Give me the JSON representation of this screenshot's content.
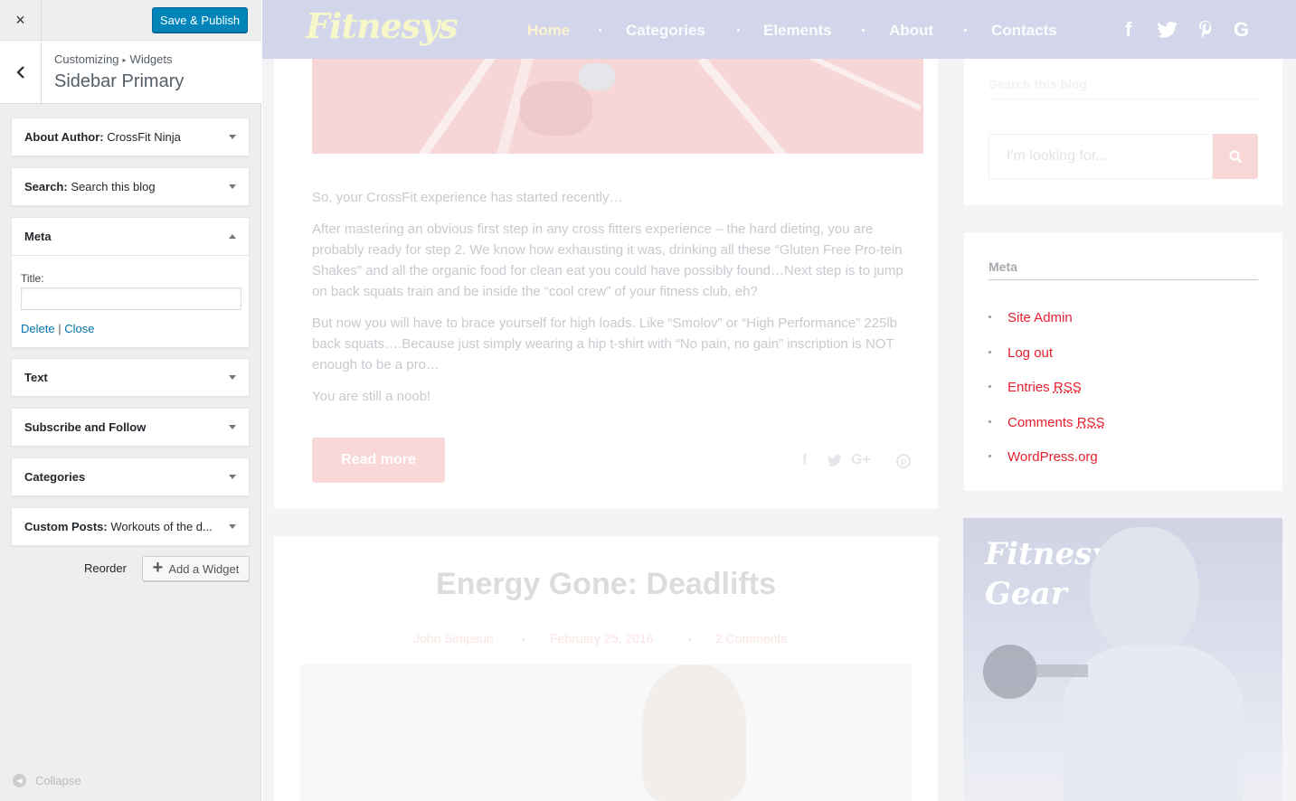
{
  "customizer": {
    "close_label": "×",
    "publish_label": "Save & Publish",
    "breadcrumb": [
      "Customizing",
      "Widgets"
    ],
    "section_title": "Sidebar Primary",
    "widgets": [
      {
        "name": "About Author",
        "value": "CrossFit Ninja"
      },
      {
        "name": "Search",
        "value": "Search this blog"
      },
      {
        "name": "Meta",
        "value": ""
      },
      {
        "name": "Text",
        "value": ""
      },
      {
        "name": "Subscribe and Follow",
        "value": ""
      },
      {
        "name": "Categories",
        "value": ""
      },
      {
        "name": "Custom Posts",
        "value": "Workouts of the d..."
      }
    ],
    "meta_form": {
      "title_label": "Title:",
      "title_value": "",
      "delete_label": "Delete",
      "separator": "|",
      "close_label": "Close"
    },
    "reorder_label": "Reorder",
    "add_widget_label": "Add a Widget",
    "collapse_label": "Collapse"
  },
  "site": {
    "logo": "Fitnesys",
    "nav": [
      "Home",
      "Categories",
      "Elements",
      "About",
      "Contacts"
    ],
    "active_nav": "Home",
    "social_icons": [
      "facebook-icon",
      "twitter-icon",
      "pinterest-icon",
      "google-icon"
    ]
  },
  "post1": {
    "paragraphs": [
      "So, your CrossFit experience has started recently…",
      "After mastering an obvious first step in any cross fitters experience – the hard dieting, you are probably ready for step 2. We know how exhausting it was, drinking all these “Gluten Free Pro-tein Shakes” and all the organic food for clean eat you could have possibly found…Next step is to jump on back squats train and be inside the “cool crew” of your fitness club, eh?",
      "But now you will have to brace yourself for high loads. Like “Smolov” or “High Performance” 225lb back squats….Because just simply wearing a hip t-shirt with “No pain, no gain” inscription is NOT enough to be a pro…",
      "You are still a noob!"
    ],
    "read_more_label": "Read more",
    "share_icons": [
      "facebook-icon",
      "twitter-icon",
      "google-plus-icon",
      "pinterest-icon"
    ]
  },
  "post2": {
    "title": "Energy Gone: Deadlifts",
    "author": "John Simpsun",
    "date": "February 25, 2016",
    "comments": "2 Comments"
  },
  "sidebar": {
    "search_title": "Search this blog",
    "search_placeholder": "I'm looking for...",
    "meta_title": "Meta",
    "meta_links": [
      {
        "text": "Site Admin",
        "abbr": ""
      },
      {
        "text": "Log out",
        "abbr": ""
      },
      {
        "text": "Entries ",
        "abbr": "RSS"
      },
      {
        "text": "Comments ",
        "abbr": "RSS"
      },
      {
        "text": "WordPress.org",
        "abbr": ""
      }
    ],
    "gear_line1": "Fitnesys",
    "gear_line2": "Gear"
  },
  "colors": {
    "publish": "#0085ba",
    "link": "#0073aa",
    "meta_link": "#e8202e",
    "navbar": "#d3d6ea"
  }
}
